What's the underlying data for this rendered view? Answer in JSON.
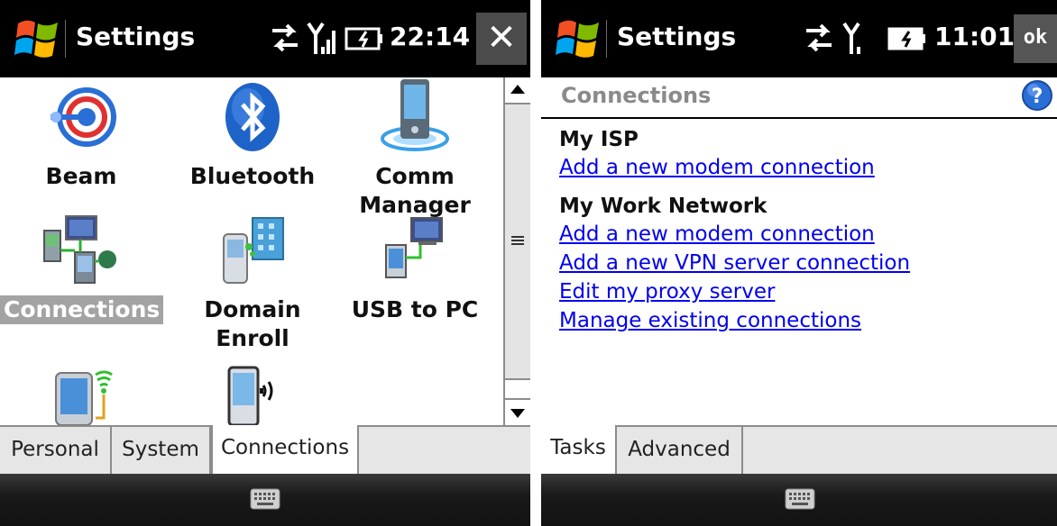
{
  "left": {
    "title": "Settings",
    "time": "22:14",
    "close_label": "✕",
    "tiles": [
      {
        "label": "Beam",
        "icon": "beam-icon",
        "selected": false
      },
      {
        "label": "Bluetooth",
        "icon": "bluetooth-icon",
        "selected": false
      },
      {
        "label": "Comm Manager",
        "icon": "comm-manager-icon",
        "selected": false
      },
      {
        "label": "Connections",
        "icon": "connections-icon",
        "selected": true
      },
      {
        "label": "Domain Enroll",
        "icon": "domain-enroll-icon",
        "selected": false
      },
      {
        "label": "USB to PC",
        "icon": "usb-to-pc-icon",
        "selected": false
      },
      {
        "label": "",
        "icon": "wireless-device-icon",
        "selected": false
      },
      {
        "label": "",
        "icon": "phone-sound-icon",
        "selected": false
      }
    ],
    "tabs": [
      "Personal",
      "System",
      "Connections"
    ],
    "active_tab": "Connections"
  },
  "right": {
    "title": "Settings",
    "time": "11:01",
    "ok_label": "ok",
    "header": "Connections",
    "groups": [
      {
        "title": "My ISP",
        "links": [
          "Add a new modem connection"
        ]
      },
      {
        "title": "My Work Network",
        "links": [
          "Add a new modem connection",
          "Add a new VPN server connection",
          "Edit my proxy server",
          "Manage existing connections"
        ]
      }
    ],
    "tabs": [
      "Tasks",
      "Advanced"
    ],
    "active_tab": "Tasks"
  },
  "colors": {
    "titlebar": "#000000",
    "link": "#0000ee",
    "selection": "#a3a3a3",
    "header_text": "#8a8a8a"
  }
}
